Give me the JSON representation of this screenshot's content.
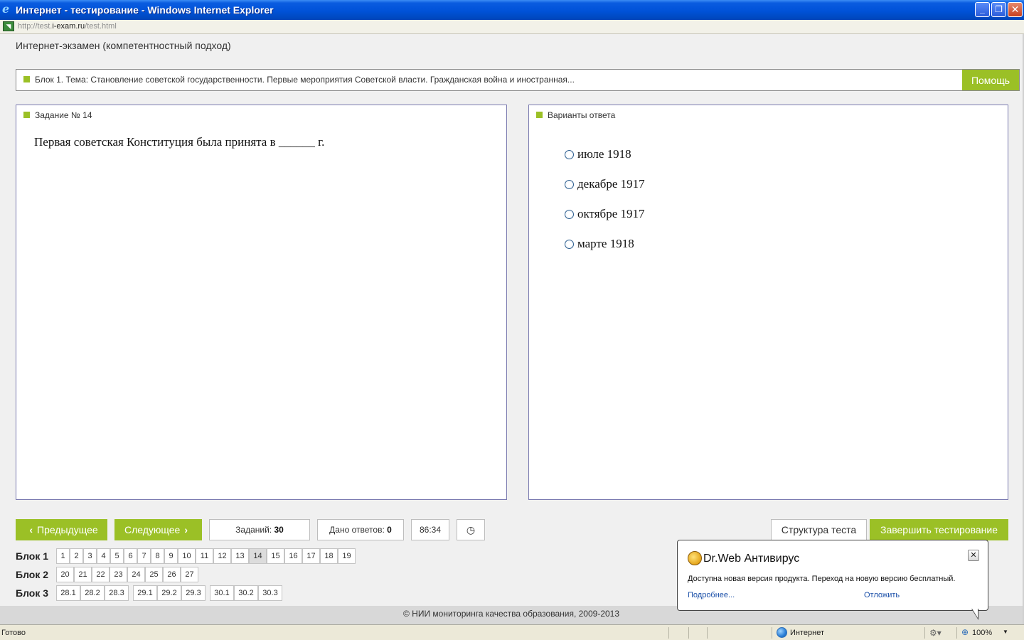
{
  "window": {
    "title": "Интернет - тестирование - Windows Internet Explorer",
    "url_prefix": "http://test.",
    "url_domain": "i-exam.ru",
    "url_suffix": "/test.html"
  },
  "app": {
    "title": "Интернет-экзамен (компетентностный подход)",
    "block_topic": "Блок 1. Тема: Становление советской государственности. Первые мероприятия Советской власти. Гражданская война и иностранная...",
    "help_label": "Помощь"
  },
  "task": {
    "title": "Задание № 14",
    "question": "Первая советская Конституция была принята в ______ г."
  },
  "answers": {
    "title": "Варианты ответа",
    "options": [
      "июле 1918",
      "декабре 1917",
      "октябре 1917",
      "марте 1918"
    ]
  },
  "controls": {
    "prev_label": "Предыдущее",
    "next_label": "Следующее",
    "tasks_label": "Заданий:",
    "tasks_count": "30",
    "answered_label": "Дано ответов:",
    "answered_count": "0",
    "timer": "86:34",
    "clock_icon": "clock-icon",
    "structure_label": "Структура теста",
    "finish_label": "Завершить тестирование"
  },
  "navigation": {
    "current": "14",
    "blocks": [
      {
        "label": "Блок 1",
        "items": [
          "1",
          "2",
          "3",
          "4",
          "5",
          "6",
          "7",
          "8",
          "9",
          "10",
          "11",
          "12",
          "13",
          "14",
          "15",
          "16",
          "17",
          "18",
          "19"
        ]
      },
      {
        "label": "Блок 2",
        "items": [
          "20",
          "21",
          "22",
          "23",
          "24",
          "25",
          "26",
          "27"
        ]
      },
      {
        "label": "Блок 3",
        "items": [
          "28.1",
          "28.2",
          "28.3",
          "29.1",
          "29.2",
          "29.3",
          "30.1",
          "30.2",
          "30.3"
        ]
      }
    ]
  },
  "footer": "© НИИ мониторинга качества образования, 2009-2013",
  "statusbar": {
    "status": "Готово",
    "zone": "Интернет",
    "zoom": "100%"
  },
  "drweb": {
    "title": "Dr.Web Антивирус",
    "message": "Доступна новая версия продукта. Переход на новую версию бесплатный.",
    "more_link": "Подробнее...",
    "postpone_link": "Отложить"
  }
}
